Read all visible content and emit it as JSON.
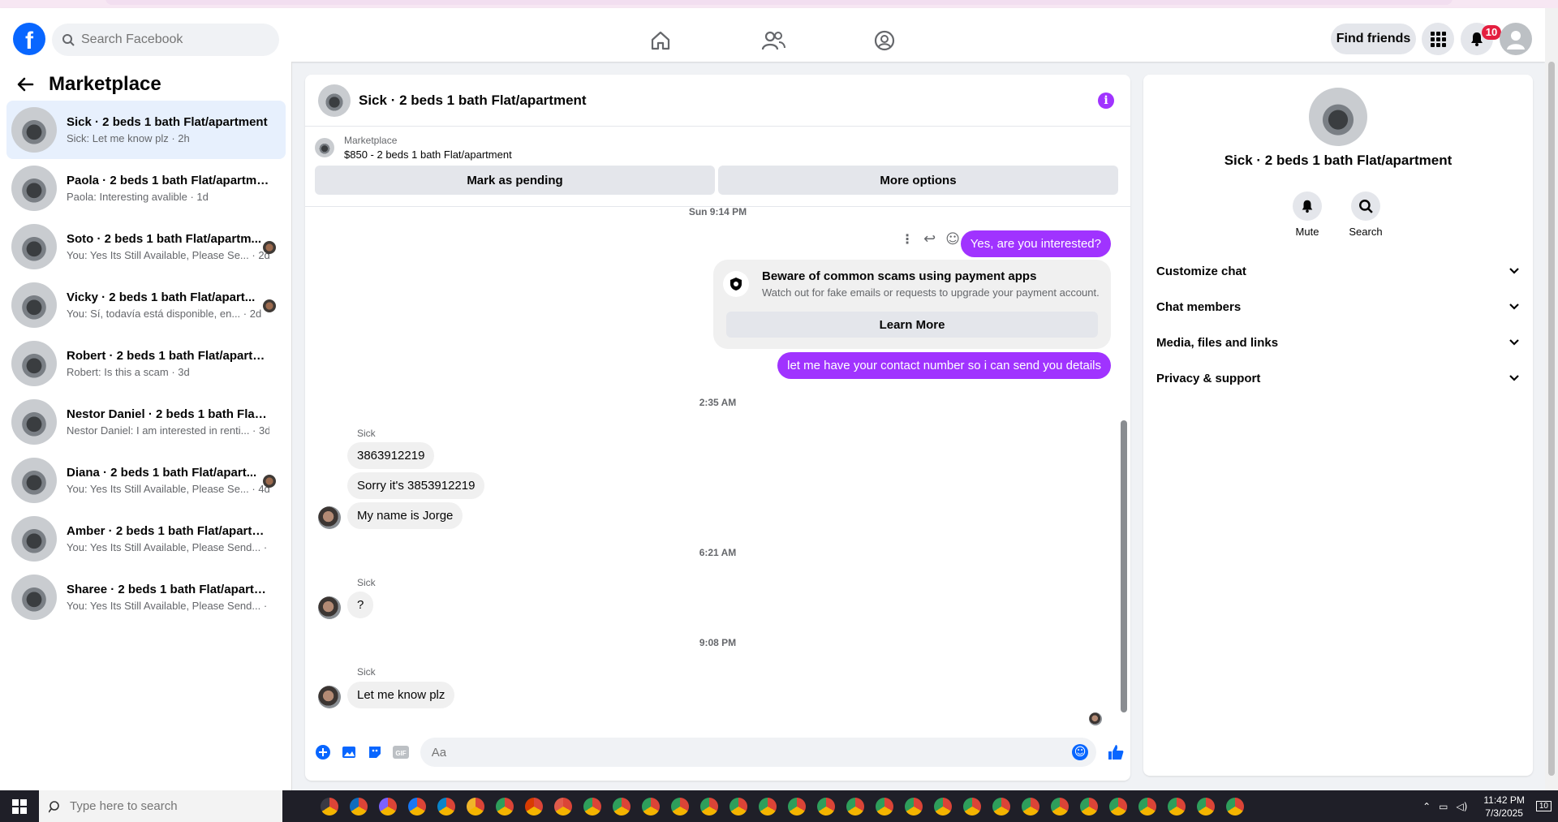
{
  "header": {
    "search_placeholder": "Search Facebook",
    "find_friends": "Find friends",
    "notification_count": "10"
  },
  "sidebar": {
    "title": "Marketplace",
    "conversations": [
      {
        "name": "Sick · 2 beds 1 bath Flat/apartment",
        "preview": "Sick: Let me know plz · 2h",
        "active": true
      },
      {
        "name": "Paola · 2 beds 1 bath Flat/apartment",
        "preview": "Paola: Interesting avalible · 1d"
      },
      {
        "name": "Soto · 2 beds 1 bath Flat/apartm...",
        "preview": "You: Yes Its Still Available, Please Se... · 2d"
      },
      {
        "name": "Vicky · 2 beds 1 bath Flat/apart...",
        "preview": "You: Sí, todavía está disponible, en... · 2d"
      },
      {
        "name": "Robert · 2 beds 1 bath Flat/apartm...",
        "preview": "Robert: Is this a scam · 3d"
      },
      {
        "name": "Nestor Daniel · 2 beds 1 bath Flat/...",
        "preview": "Nestor Daniel: I am interested in renti... · 3d"
      },
      {
        "name": "Diana · 2 beds 1 bath Flat/apart...",
        "preview": "You: Yes Its Still Available, Please Se... · 4d"
      },
      {
        "name": "Amber · 2 beds 1 bath Flat/apartm...",
        "preview": "You: Yes Its Still Available, Please Send... · 4d"
      },
      {
        "name": "Sharee · 2 beds 1 bath Flat/apartm...",
        "preview": "You: Yes Its Still Available, Please Send... · 4d"
      }
    ]
  },
  "chat": {
    "title": "Sick · 2 beds 1 bath Flat/apartment",
    "marketplace_label": "Marketplace",
    "listing": "$850 - 2 beds 1 bath Flat/apartment",
    "mark_pending": "Mark as pending",
    "more_options": "More options",
    "ts1": "Sun 9:14 PM",
    "out1": "Yes, are you interested?",
    "scam_title": "Beware of common scams using payment apps",
    "scam_sub": "Watch out for fake emails or requests to upgrade your payment account.",
    "learn_more": "Learn More",
    "out2": "let me have your contact number so i can send you details",
    "ts2": "2:35 AM",
    "sender": "Sick",
    "in1": "3863912219",
    "in2": "Sorry it's 3853912219",
    "in3": "My name is Jorge",
    "ts3": "6:21 AM",
    "in4": "?",
    "ts4": "9:08 PM",
    "in5": "Let me know plz",
    "composer_placeholder": "Aa"
  },
  "right_panel": {
    "title": "Sick · 2 beds 1 bath Flat/apartment",
    "mute": "Mute",
    "search": "Search",
    "sections": [
      "Customize chat",
      "Chat members",
      "Media, files and links",
      "Privacy & support"
    ]
  },
  "taskbar": {
    "search_placeholder": "Type here to search",
    "time": "11:42 PM",
    "date": "7/3/2025",
    "notif": "10"
  },
  "colors": {
    "accent": "#a033ff",
    "fb_blue": "#0866ff"
  }
}
